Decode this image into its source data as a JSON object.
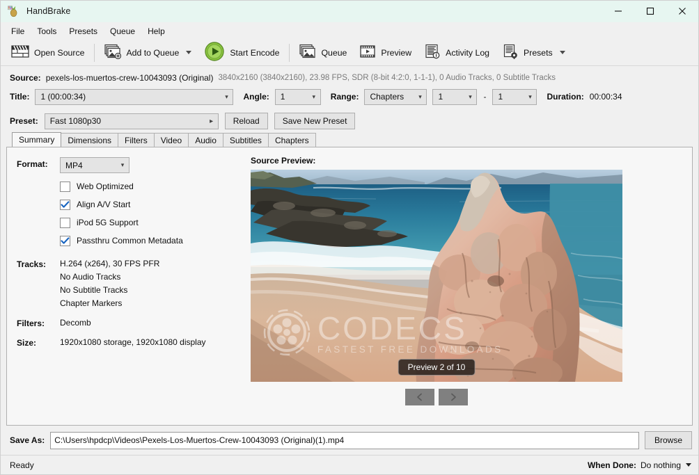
{
  "window": {
    "title": "HandBrake",
    "app_icon": "handbrake-pineapple-icon",
    "minimize": "—",
    "maximize": "☐",
    "close": "✕",
    "titlebar_color": "#e7f6f1"
  },
  "menubar": {
    "items": [
      {
        "label": "File"
      },
      {
        "label": "Tools"
      },
      {
        "label": "Presets"
      },
      {
        "label": "Queue"
      },
      {
        "label": "Help"
      }
    ]
  },
  "toolbar": {
    "open_source": "Open Source",
    "add_to_queue": "Add to Queue",
    "start_encode": "Start Encode",
    "queue": "Queue",
    "preview": "Preview",
    "activity_log": "Activity Log",
    "presets": "Presets",
    "start_encode_color": "#7cc043"
  },
  "source": {
    "label": "Source:",
    "name": "pexels-los-muertos-crew-10043093 (Original)",
    "meta": "3840x2160 (3840x2160), 23.98 FPS, SDR (8-bit 4:2:0, 1-1-1), 0 Audio Tracks, 0 Subtitle Tracks"
  },
  "title_row": {
    "title_label": "Title:",
    "title_value": "1 (00:00:34)",
    "angle_label": "Angle:",
    "angle_value": "1",
    "range_label": "Range:",
    "range_value": "Chapters",
    "chapter_start": "1",
    "range_separator": "-",
    "chapter_end": "1",
    "duration_label": "Duration:",
    "duration_value": "00:00:34"
  },
  "preset_row": {
    "label": "Preset:",
    "value": "Fast 1080p30",
    "reload": "Reload",
    "save_new_preset": "Save New Preset"
  },
  "tabs": [
    {
      "label": "Summary",
      "active": true
    },
    {
      "label": "Dimensions",
      "active": false
    },
    {
      "label": "Filters",
      "active": false
    },
    {
      "label": "Video",
      "active": false
    },
    {
      "label": "Audio",
      "active": false
    },
    {
      "label": "Subtitles",
      "active": false
    },
    {
      "label": "Chapters",
      "active": false
    }
  ],
  "summary": {
    "format_label": "Format:",
    "format_value": "MP4",
    "checkboxes": [
      {
        "label": "Web Optimized",
        "checked": false
      },
      {
        "label": "Align A/V Start",
        "checked": true
      },
      {
        "label": "iPod 5G Support",
        "checked": false
      },
      {
        "label": "Passthru Common Metadata",
        "checked": true
      }
    ],
    "tracks_label": "Tracks:",
    "tracks": [
      "H.264 (x264), 30 FPS PFR",
      "No Audio Tracks",
      "No Subtitle Tracks",
      "Chapter Markers"
    ],
    "filters_label": "Filters:",
    "filters_value": "Decomb",
    "size_label": "Size:",
    "size_value": "1920x1080 storage, 1920x1080 display"
  },
  "preview": {
    "title": "Source Preview:",
    "badge": "Preview 2 of 10",
    "prev_button": "<",
    "next_button": ">",
    "watermark_main": "CODECS",
    "watermark_sub": "FASTEST FREE DOWNLOADS"
  },
  "save_as": {
    "label": "Save As:",
    "value": "C:\\Users\\hpdcp\\Videos\\Pexels-Los-Muertos-Crew-10043093 (Original)(1).mp4",
    "browse": "Browse"
  },
  "statusbar": {
    "status": "Ready",
    "when_done_label": "When Done:",
    "when_done_value": "Do nothing"
  }
}
